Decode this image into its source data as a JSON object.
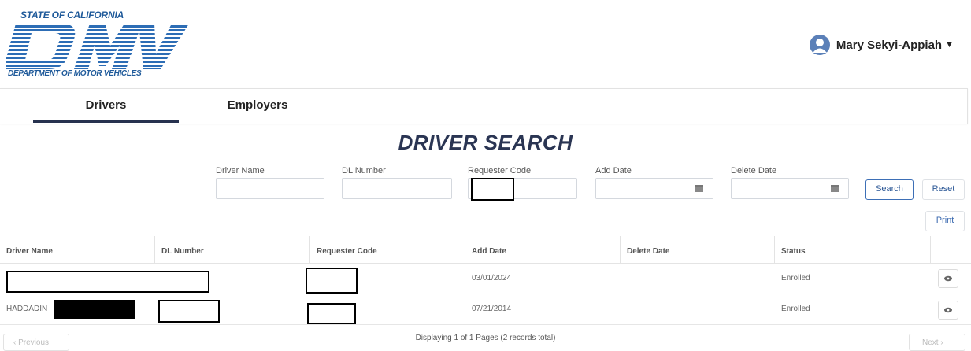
{
  "header": {
    "logo": {
      "top_text": "STATE OF CALIFORNIA",
      "main_text": "DMV",
      "bottom_text": "DEPARTMENT OF MOTOR VEHICLES"
    },
    "user": {
      "name": "Mary Sekyi-Appiah",
      "avatar_icon": "user-avatar-icon",
      "caret_icon": "caret-down-icon"
    }
  },
  "tabs": [
    {
      "label": "Drivers",
      "active": true
    },
    {
      "label": "Employers",
      "active": false
    }
  ],
  "page": {
    "title": "DRIVER SEARCH"
  },
  "filters": {
    "driver_name": {
      "label": "Driver Name",
      "value": ""
    },
    "dl_number": {
      "label": "DL Number",
      "value": ""
    },
    "requester_code": {
      "label": "Requester Code",
      "value": ""
    },
    "add_date": {
      "label": "Add Date",
      "value": "",
      "icon": "calendar-icon"
    },
    "delete_date": {
      "label": "Delete Date",
      "value": "",
      "icon": "calendar-icon"
    }
  },
  "buttons": {
    "search": "Search",
    "reset": "Reset",
    "print": "Print"
  },
  "table": {
    "columns": [
      "Driver Name",
      "DL Number",
      "Requester Code",
      "Add Date",
      "Delete Date",
      "Status"
    ],
    "rows": [
      {
        "driver_name": "",
        "dl_number": "",
        "requester_code": "",
        "add_date": "03/01/2024",
        "delete_date": "",
        "status": "Enrolled",
        "action_icon": "eye-icon"
      },
      {
        "driver_name": "HADDADIN",
        "dl_number": "",
        "requester_code": "",
        "add_date": "07/21/2014",
        "delete_date": "",
        "status": "Enrolled",
        "action_icon": "eye-icon"
      }
    ]
  },
  "pagination": {
    "previous_label": "Previous",
    "next_label": "Next",
    "status_text": "Displaying 1 of 1 Pages (2 records total)"
  },
  "colors": {
    "brand_blue": "#1f5a9a",
    "title_navy": "#2a3553",
    "tab_underline": "#27324f",
    "button_border": "#3d6fb6"
  }
}
